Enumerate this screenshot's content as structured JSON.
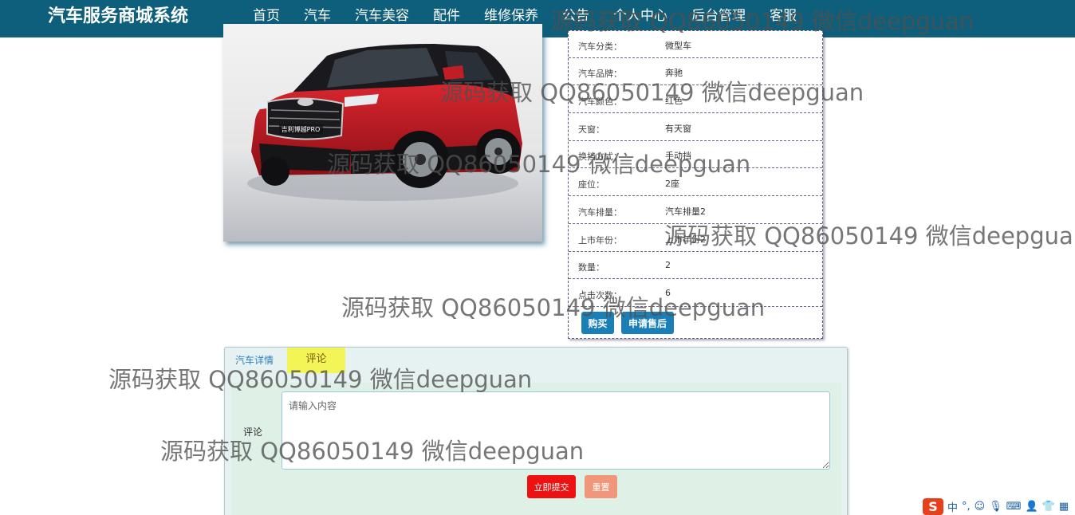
{
  "nav": {
    "brand": "汽车服务商城系统",
    "items": [
      "首页",
      "汽车",
      "汽车美容",
      "配件",
      "维修保养",
      "公告",
      "个人中心",
      "后台管理",
      "客服"
    ],
    "active_index": 1
  },
  "car_image": {
    "badge": "吉利博越PRO"
  },
  "info": {
    "rows": [
      {
        "label": "汽车分类：",
        "value": "微型车"
      },
      {
        "label": "汽车品牌：",
        "value": "奔驰"
      },
      {
        "label": "汽车颜色：",
        "value": "红色"
      },
      {
        "label": "天窗：",
        "value": "有天窗"
      },
      {
        "label": "换挡方式：",
        "value": "手动挡"
      },
      {
        "label": "座位：",
        "value": "2座"
      },
      {
        "label": "汽车排量：",
        "value": "汽车排量2"
      },
      {
        "label": "上市年份：",
        "value": "上市年份2"
      },
      {
        "label": "数量：",
        "value": "2"
      },
      {
        "label": "点击次数：",
        "value": "6"
      }
    ],
    "buy_label": "购买",
    "after_sale_label": "申请售后"
  },
  "tabs": {
    "detail_label": "汽车详情",
    "comment_label": "评论"
  },
  "comment": {
    "label": "评论",
    "placeholder": "请输入内容",
    "submit_label": "立即提交",
    "reset_label": "重置"
  },
  "watermark": "源码获取 QQ86050149 微信deepguan",
  "ime": {
    "logo": "S",
    "lang": "中"
  },
  "colors": {
    "nav_bg": "#0d5f7c",
    "button_blue": "#1a7fb6",
    "submit_red": "#ee1111",
    "reset_salmon": "#f0967a",
    "tab_active": "#f3f557"
  }
}
